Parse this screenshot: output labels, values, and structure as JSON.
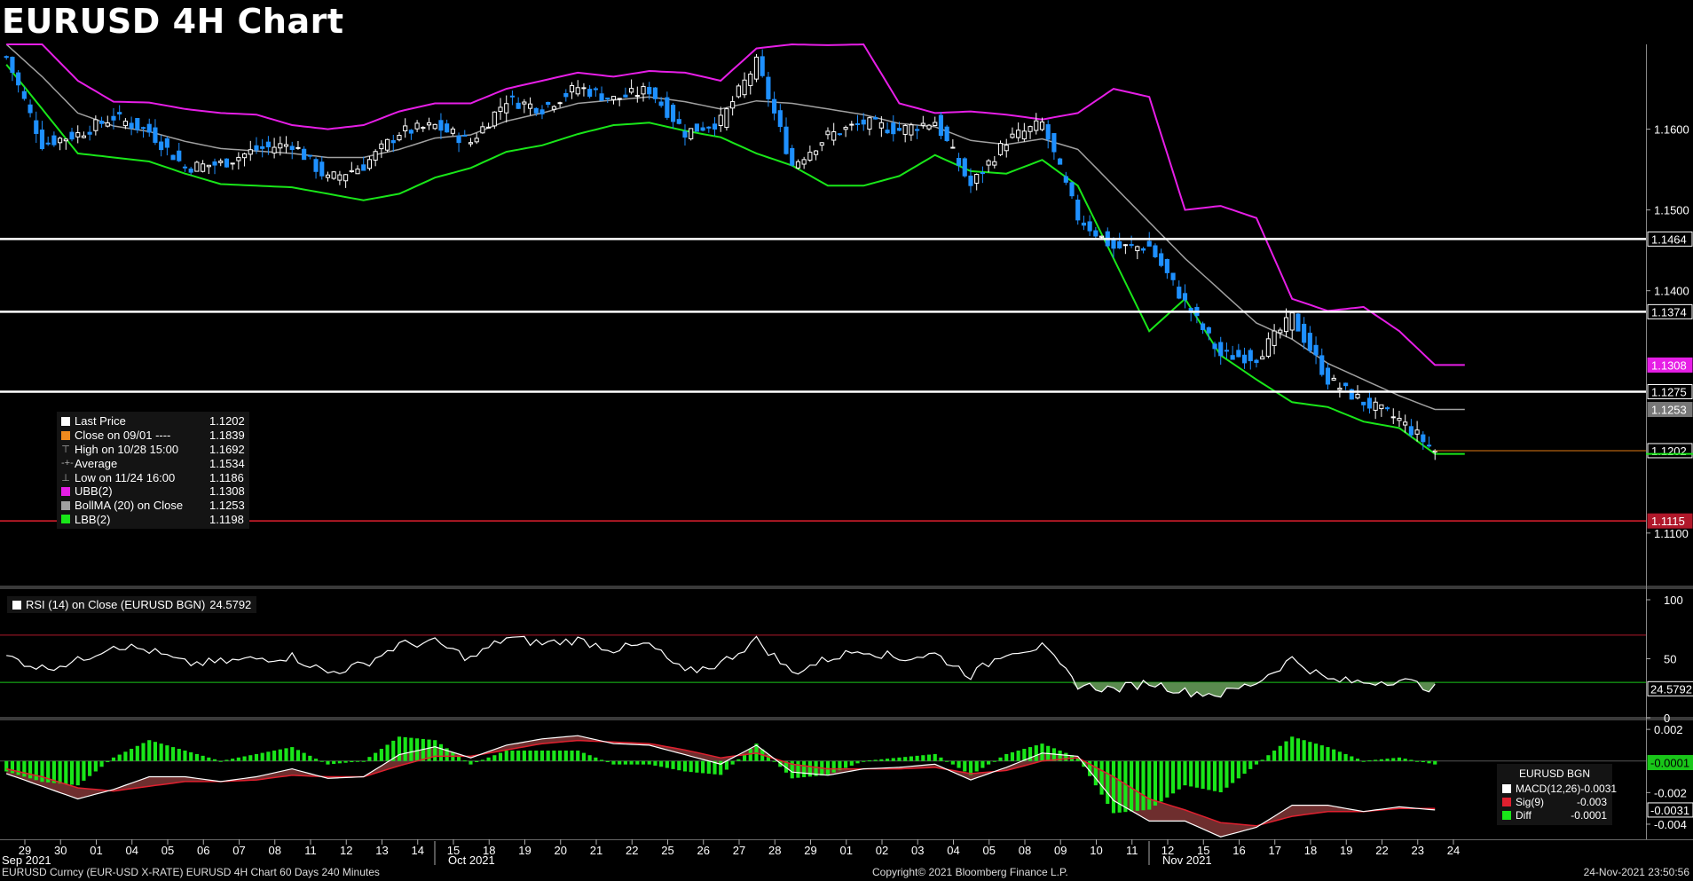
{
  "title": "EURUSD 4H Chart",
  "colors": {
    "up": "#ffffff",
    "down": "#1e90ff",
    "ubb": "#e61ee6",
    "lbb": "#19e619",
    "ma": "#a0a0a0",
    "support": "#ffffff",
    "red_line": "#e0202f",
    "last_line": "#e07a14"
  },
  "legend": {
    "rows": [
      {
        "label": "Last Price",
        "value": "1.1202",
        "swatch": "#ffffff",
        "icon": ""
      },
      {
        "label": "Close on 09/01 ----",
        "value": "1.1839",
        "swatch": "#ee8a1e",
        "icon": ""
      },
      {
        "label": "High on 10/28 15:00",
        "value": "1.1692",
        "swatch": "",
        "icon": "⊤"
      },
      {
        "label": "Average",
        "value": "1.1534",
        "swatch": "",
        "icon": "-+-"
      },
      {
        "label": "Low on 11/24 16:00",
        "value": "1.1186",
        "swatch": "",
        "icon": "⊥"
      },
      {
        "label": "UBB(2)",
        "value": "1.1308",
        "swatch": "#e61ee6",
        "icon": ""
      },
      {
        "label": "BollMA (20)  on Close",
        "value": "1.1253",
        "swatch": "#a0a0a0",
        "icon": ""
      },
      {
        "label": "LBB(2)",
        "value": "1.1198",
        "swatch": "#19e619",
        "icon": ""
      }
    ]
  },
  "rsi_legend": {
    "label": "RSI (14)  on Close (EURUSD BGN)",
    "value": "24.5792"
  },
  "macd_legend": {
    "title": "EURUSD BGN",
    "rows": [
      {
        "label": "MACD(12,26)",
        "value": "-0.0031",
        "swatch": "#ffffff"
      },
      {
        "label": "Sig(9)",
        "value": "-0.003",
        "swatch": "#e0202f"
      },
      {
        "label": "Diff",
        "value": "-0.0001",
        "swatch": "#19e619"
      }
    ]
  },
  "footer": {
    "left": "EURUSD Curncy (EUR-USD X-RATE) EURUSD 4H Chart 60 Days 240 Minutes",
    "mid": "Copyright© 2021 Bloomberg Finance L.P.",
    "right": "24-Nov-2021 23:50:56"
  },
  "chart_data": {
    "type": "candlestick",
    "price_axis": {
      "ticks": [
        "1.1600",
        "1.1500",
        "1.1400",
        "1.1100"
      ],
      "range": [
        1.1035,
        1.1705
      ]
    },
    "price_labels": [
      {
        "value": 1.1464,
        "text": "1.1464",
        "style": "white"
      },
      {
        "value": 1.1374,
        "text": "1.1374",
        "style": "white"
      },
      {
        "value": 1.1308,
        "text": "1.1308",
        "style": "magenta"
      },
      {
        "value": 1.1275,
        "text": "1.1275",
        "style": "white"
      },
      {
        "value": 1.1253,
        "text": "1.1253",
        "style": "gray"
      },
      {
        "value": 1.1202,
        "text": "1.1202",
        "style": "white"
      },
      {
        "value": 1.1115,
        "text": "1.1115",
        "style": "red"
      }
    ],
    "horizontal_lines": [
      {
        "value": 1.1464,
        "kind": "support"
      },
      {
        "value": 1.1374,
        "kind": "support"
      },
      {
        "value": 1.1275,
        "kind": "support"
      },
      {
        "value": 1.1115,
        "kind": "red"
      }
    ],
    "x_axis": {
      "days": [
        "29",
        "30",
        "01",
        "04",
        "05",
        "06",
        "07",
        "08",
        "11",
        "12",
        "13",
        "14",
        "15",
        "18",
        "19",
        "20",
        "21",
        "22",
        "25",
        "26",
        "27",
        "28",
        "29",
        "01",
        "02",
        "03",
        "04",
        "05",
        "08",
        "09",
        "10",
        "11",
        "12",
        "15",
        "16",
        "17",
        "18",
        "19",
        "22",
        "23",
        "24"
      ],
      "months": [
        {
          "label": "Sep 2021",
          "index": 0
        },
        {
          "label": "Oct 2021",
          "index": 12
        },
        {
          "label": "Nov 2021",
          "index": 32
        }
      ]
    },
    "daily_close": [
      1.1689,
      1.1582,
      1.1594,
      1.1615,
      1.1597,
      1.1553,
      1.1557,
      1.1575,
      1.1582,
      1.1538,
      1.1555,
      1.1596,
      1.1604,
      1.1584,
      1.1637,
      1.1626,
      1.1652,
      1.1637,
      1.1649,
      1.1596,
      1.161,
      1.1682,
      1.1556,
      1.1592,
      1.1608,
      1.1599,
      1.161,
      1.153,
      1.1586,
      1.1607,
      1.1491,
      1.1453,
      1.1455,
      1.1385,
      1.132,
      1.1318,
      1.1367,
      1.129,
      1.1262,
      1.124,
      1.1202
    ],
    "bollinger": {
      "ubb": [
        1.1705,
        1.1705,
        1.166,
        1.1634,
        1.1633,
        1.1625,
        1.162,
        1.1618,
        1.1605,
        1.16,
        1.1605,
        1.1622,
        1.1632,
        1.1632,
        1.165,
        1.166,
        1.167,
        1.1665,
        1.1672,
        1.167,
        1.166,
        1.17,
        1.1705,
        1.1704,
        1.1705,
        1.1632,
        1.162,
        1.1622,
        1.1618,
        1.1612,
        1.162,
        1.165,
        1.164,
        1.15,
        1.1505,
        1.149,
        1.139,
        1.1375,
        1.138,
        1.135,
        1.1308
      ],
      "ma": [
        1.1705,
        1.1665,
        1.162,
        1.1604,
        1.1597,
        1.1585,
        1.1576,
        1.1573,
        1.157,
        1.1565,
        1.1565,
        1.1575,
        1.1589,
        1.1593,
        1.161,
        1.162,
        1.1632,
        1.1636,
        1.164,
        1.1634,
        1.1625,
        1.1635,
        1.1632,
        1.1625,
        1.1618,
        1.1607,
        1.1603,
        1.1586,
        1.1581,
        1.1588,
        1.1575,
        1.153,
        1.1485,
        1.144,
        1.14,
        1.136,
        1.134,
        1.131,
        1.129,
        1.127,
        1.1253
      ],
      "lbb": [
        1.168,
        1.1625,
        1.157,
        1.1565,
        1.156,
        1.1545,
        1.1532,
        1.153,
        1.1528,
        1.152,
        1.1512,
        1.152,
        1.154,
        1.1552,
        1.1572,
        1.158,
        1.1594,
        1.1605,
        1.1608,
        1.1598,
        1.159,
        1.157,
        1.1555,
        1.153,
        1.153,
        1.1542,
        1.1568,
        1.1548,
        1.1545,
        1.1562,
        1.153,
        1.144,
        1.135,
        1.139,
        1.132,
        1.129,
        1.1262,
        1.1256,
        1.1238,
        1.123,
        1.1198
      ]
    },
    "rsi": {
      "axis_ticks": [
        100,
        50,
        0
      ],
      "levels": [
        70,
        30
      ],
      "daily": [
        52,
        42,
        48,
        62,
        57,
        46,
        47,
        50,
        52,
        38,
        45,
        62,
        64,
        50,
        68,
        63,
        66,
        58,
        62,
        38,
        46,
        66,
        38,
        50,
        58,
        50,
        54,
        36,
        56,
        60,
        28,
        24,
        30,
        22,
        20,
        30,
        50,
        32,
        30,
        32,
        24.5792
      ],
      "last": 24.5792
    },
    "macd": {
      "axis_ticks": [
        "0.002",
        "-0.002",
        "-0.004"
      ],
      "axis_labels": [
        {
          "value": -0.0001,
          "text": "-0.0001",
          "style": "green"
        },
        {
          "value": -0.0031,
          "text": "-0.0031",
          "style": "white"
        }
      ],
      "range": [
        -0.0049,
        0.0024
      ],
      "macd_daily": [
        -0.0008,
        -0.0016,
        -0.0024,
        -0.0018,
        -0.001,
        -0.001,
        -0.0013,
        -0.001,
        -0.0005,
        -0.0011,
        -0.001,
        0.0004,
        0.0009,
        0.0002,
        0.001,
        0.0014,
        0.0016,
        0.0011,
        0.001,
        0.0004,
        -0.0002,
        0.001,
        -0.0007,
        -0.0009,
        -0.0005,
        -0.0004,
        -0.0002,
        -0.0012,
        -0.0004,
        0.0005,
        0.0003,
        -0.0025,
        -0.0038,
        -0.0038,
        -0.0048,
        -0.0042,
        -0.0028,
        -0.0028,
        -0.0032,
        -0.0029,
        -0.0031
      ],
      "signal_daily": [
        -0.0005,
        -0.001,
        -0.0017,
        -0.0019,
        -0.0016,
        -0.0013,
        -0.0013,
        -0.0012,
        -0.0009,
        -0.001,
        -0.001,
        -0.0003,
        0.0003,
        0.0003,
        0.0007,
        0.0011,
        0.0013,
        0.0012,
        0.0011,
        0.0007,
        0.0002,
        0.0005,
        -0.0002,
        -0.0005,
        -0.0005,
        -0.0005,
        -0.0004,
        -0.0008,
        -0.0006,
        0.0,
        0.0002,
        -0.001,
        -0.0024,
        -0.0031,
        -0.0039,
        -0.0041,
        -0.0035,
        -0.0032,
        -0.0032,
        -0.003,
        -0.003
      ],
      "last_diff": -0.0001
    }
  }
}
